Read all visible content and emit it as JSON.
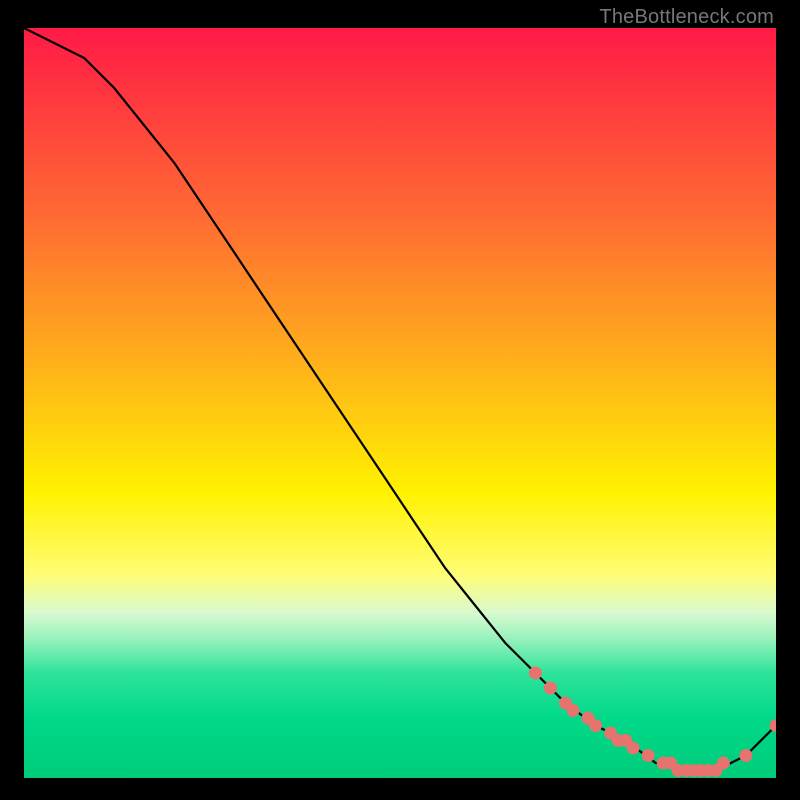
{
  "attribution": "TheBottleneck.com",
  "chart_data": {
    "type": "line",
    "title": "",
    "xlabel": "",
    "ylabel": "",
    "xlim": [
      0,
      100
    ],
    "ylim": [
      0,
      100
    ],
    "grid": false,
    "legend": false,
    "series": [
      {
        "name": "curve",
        "type": "line",
        "color": "#000000",
        "x": [
          0,
          4,
          8,
          12,
          16,
          20,
          24,
          28,
          32,
          36,
          40,
          44,
          48,
          52,
          56,
          60,
          64,
          68,
          72,
          76,
          80,
          84,
          88,
          92,
          96,
          100
        ],
        "y": [
          100,
          98,
          96,
          92,
          87,
          82,
          76,
          70,
          64,
          58,
          52,
          46,
          40,
          34,
          28,
          23,
          18,
          14,
          10,
          7,
          5,
          2,
          1,
          1,
          3,
          7
        ]
      },
      {
        "name": "markers",
        "type": "scatter",
        "color": "#e6736e",
        "x": [
          68,
          70,
          72,
          73,
          75,
          76,
          78,
          79,
          80,
          81,
          83,
          85,
          86,
          87,
          88,
          89,
          90,
          91,
          92,
          93,
          96,
          100
        ],
        "y": [
          14,
          12,
          10,
          9,
          8,
          7,
          6,
          5,
          5,
          4,
          3,
          2,
          2,
          1,
          1,
          1,
          1,
          1,
          1,
          2,
          3,
          7
        ]
      }
    ]
  }
}
